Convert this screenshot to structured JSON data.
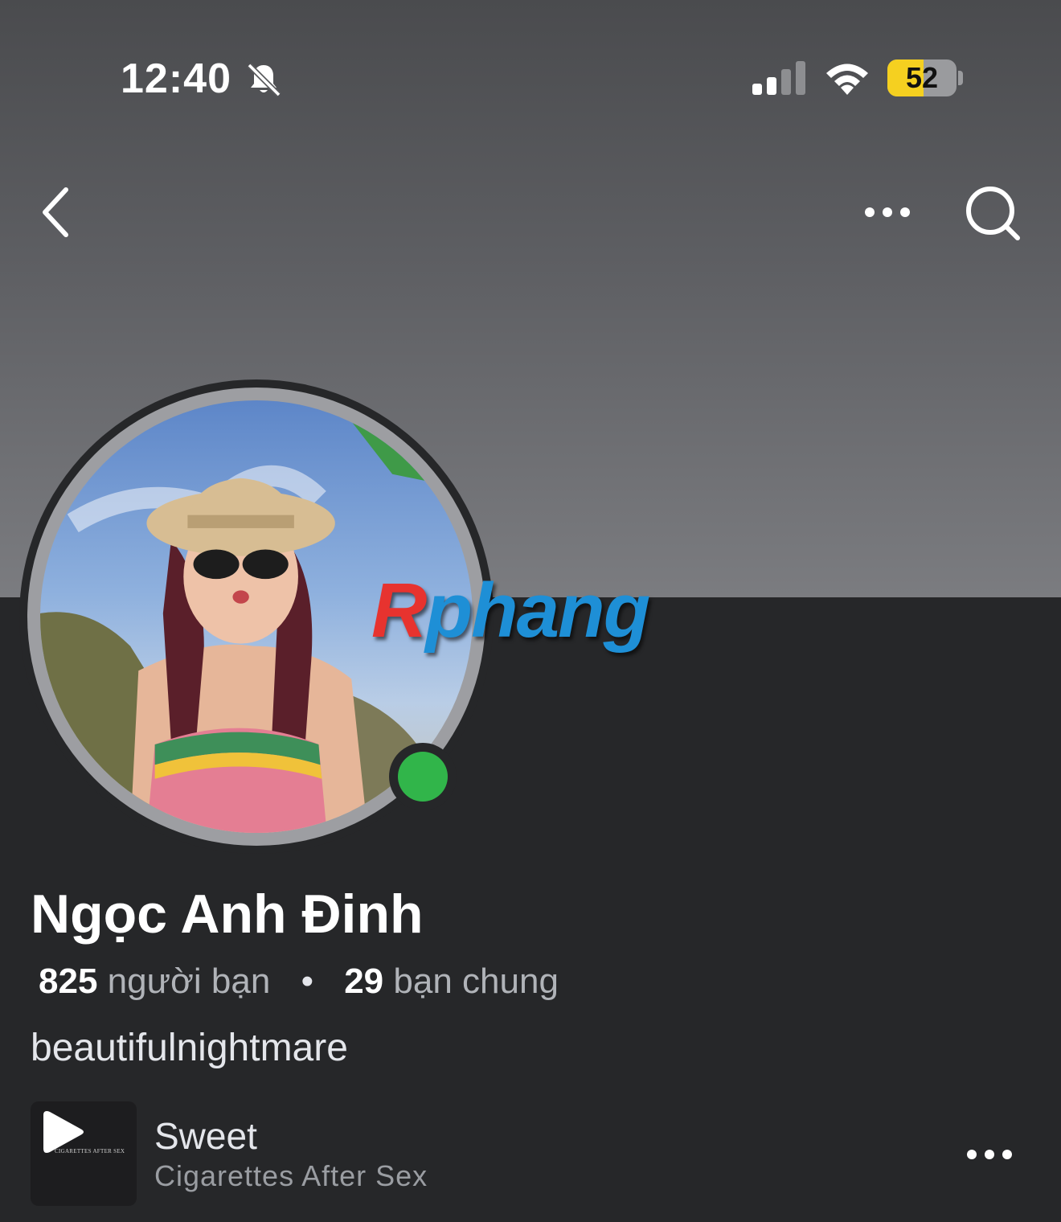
{
  "status_bar": {
    "time": "12:40",
    "battery": "52",
    "battery_level_percent": 52,
    "icons": [
      "bell-slash-icon",
      "cellular-signal-icon",
      "wifi-icon",
      "battery-icon"
    ]
  },
  "nav": {
    "icons": [
      "chevron-left-icon",
      "more-horizontal-icon",
      "search-icon"
    ]
  },
  "watermark": {
    "part1": "R",
    "part2": "phang"
  },
  "profile": {
    "name": "Ngọc Anh Đinh",
    "friends_count": "825",
    "friends_label": "người bạn",
    "separator": "•",
    "mutual_count": "29",
    "mutual_label": "bạn chung",
    "bio": "beautifulnightmare",
    "online": true
  },
  "music": {
    "title": "Sweet",
    "artist": "Cigarettes After Sex",
    "album_text": "CIGARETTES AFTER SEX"
  },
  "colors": {
    "background": "#262729",
    "online_green": "#31b54a",
    "battery_yellow": "#f5d020",
    "watermark_red": "#e7332f",
    "watermark_blue": "#1e8fd6"
  }
}
